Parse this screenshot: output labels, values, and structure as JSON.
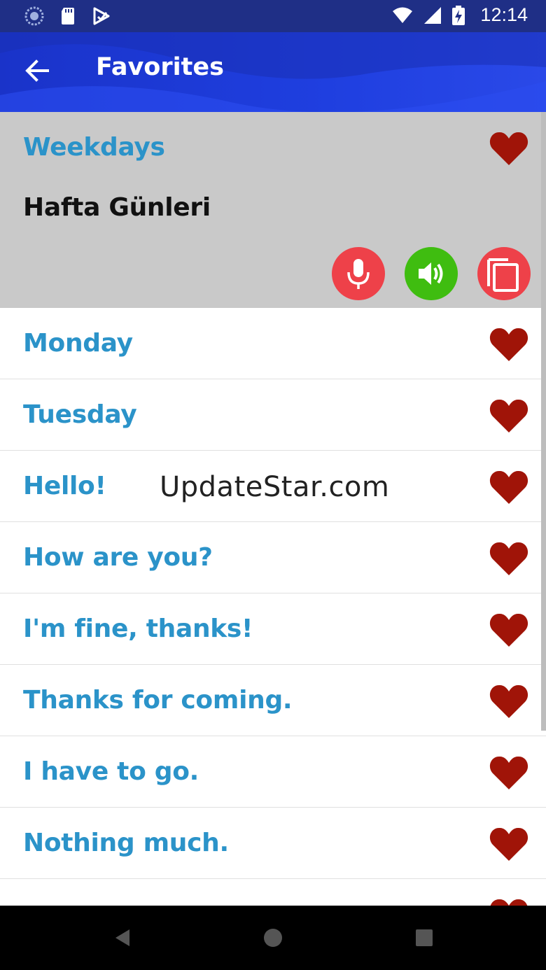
{
  "status_bar": {
    "time": "12:14",
    "left_icons": [
      "sync-icon",
      "sd-card-icon",
      "play-store-icon"
    ],
    "right_icons": [
      "wifi-icon",
      "signal-icon",
      "battery-charging-icon"
    ]
  },
  "app_bar": {
    "title": "Favorites",
    "back_icon": "arrow-left-icon"
  },
  "expanded_item": {
    "phrase": "Weekdays",
    "translation": "Hafta Günleri",
    "favorite_icon": "heart-icon",
    "actions": [
      "microphone-icon",
      "speaker-icon",
      "copy-icon"
    ]
  },
  "items": [
    {
      "phrase": "Monday"
    },
    {
      "phrase": "Tuesday"
    },
    {
      "phrase": "Hello!"
    },
    {
      "phrase": "How are you?"
    },
    {
      "phrase": "I'm fine, thanks!"
    },
    {
      "phrase": "Thanks for coming."
    },
    {
      "phrase": "I have to go."
    },
    {
      "phrase": "Nothing much."
    },
    {
      "phrase": ""
    }
  ],
  "watermark": "UpdateStar.com",
  "colors": {
    "status_bar": "#1f2f86",
    "app_bar": "#1f3fe0",
    "phrase_text": "#2b93c9",
    "heart": "#a01408",
    "expanded_bg": "#c9c9c9",
    "mic_button": "#ee4149",
    "speaker_button": "#3fbd10",
    "copy_button": "#ee4149"
  },
  "nav_bar": [
    "back-triangle-icon",
    "home-circle-icon",
    "recents-square-icon"
  ]
}
